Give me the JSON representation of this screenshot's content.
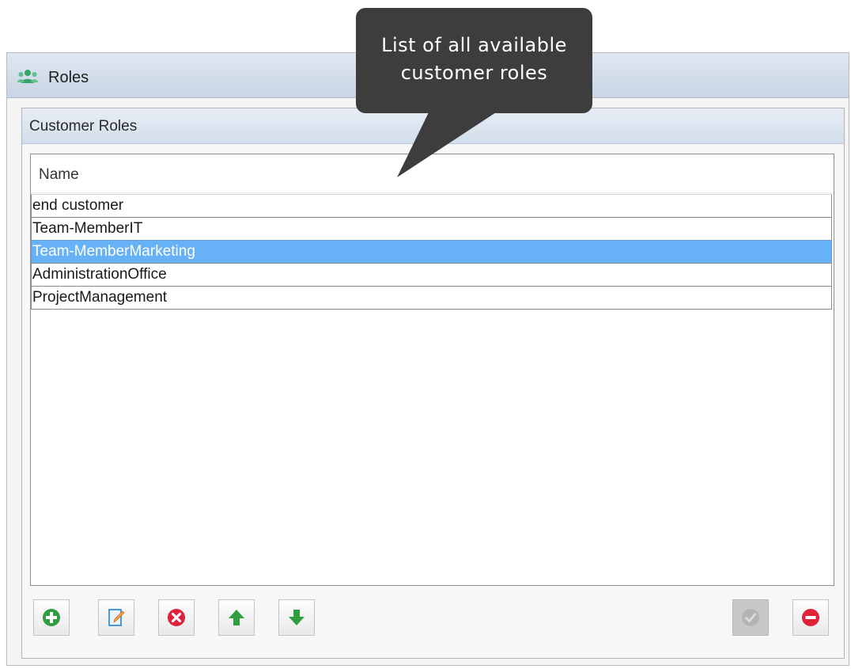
{
  "window": {
    "title": "Roles",
    "icon": "users-icon"
  },
  "group": {
    "title": "Customer Roles"
  },
  "grid": {
    "column_header": "Name",
    "rows": [
      {
        "label": "end customer",
        "selected": false
      },
      {
        "label": "Team-MemberIT",
        "selected": false
      },
      {
        "label": "Team-MemberMarketing",
        "selected": true
      },
      {
        "label": "AdministrationOffice",
        "selected": false
      },
      {
        "label": "ProjectManagement",
        "selected": false
      }
    ]
  },
  "toolbar": {
    "left": [
      {
        "icon": "add-icon",
        "color": "#2e9e3e"
      },
      {
        "icon": "edit-icon",
        "color": "#3a8fd6"
      },
      {
        "icon": "delete-icon",
        "color": "#e0213a"
      },
      {
        "icon": "arrow-up-icon",
        "color": "#2e9e3e"
      },
      {
        "icon": "arrow-down-icon",
        "color": "#2e9e3e"
      }
    ],
    "right": [
      {
        "icon": "confirm-icon",
        "enabled": false
      },
      {
        "icon": "remove-icon",
        "color": "#e0213a",
        "enabled": true
      }
    ]
  },
  "tooltip": {
    "line1": "List of all available",
    "line2": "customer roles"
  },
  "colors": {
    "selection": "#67b1f7",
    "tooltip_bg": "#3d3d3d",
    "title_bar": "#c9d5e4"
  }
}
